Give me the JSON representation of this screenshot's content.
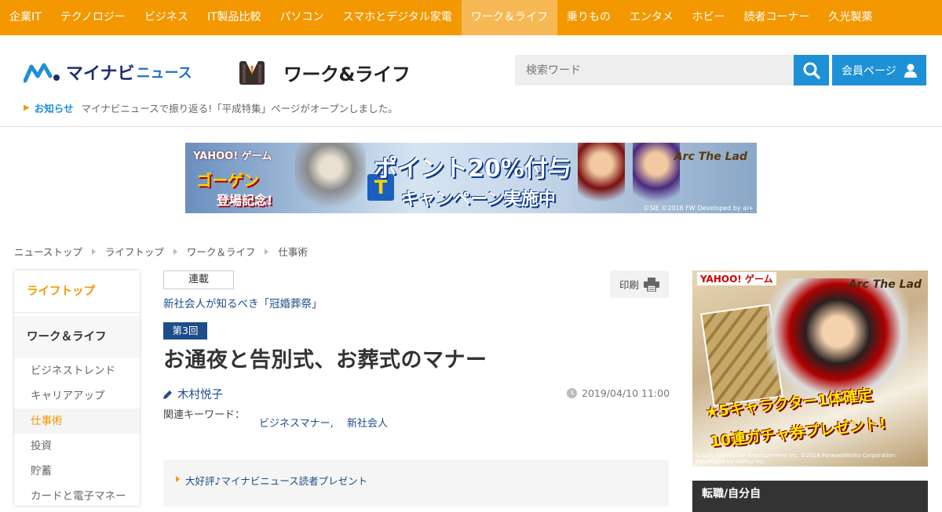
{
  "topnav": {
    "items": [
      "企業IT",
      "テクノロジー",
      "ビジネス",
      "IT製品比較",
      "パソコン",
      "スマホとデジタル家電",
      "ワーク＆ライフ",
      "乗りもの",
      "エンタメ",
      "ホビー",
      "読者コーナー",
      "久光製薬"
    ],
    "active_index": 6
  },
  "header": {
    "logo_main": "マイナビ",
    "logo_sub": "ニュース",
    "section_title": "ワーク&ライフ",
    "search_placeholder": "検索ワード",
    "member_label": "会員ページ",
    "notice_tag": "お知らせ",
    "notice_text": "マイナビニュースで振り返る!「平成特集」ページがオープンしました。"
  },
  "banner_ad": {
    "yahoo": "YAHOO! ゲーム",
    "headline1": "ゴーゲン",
    "headline2": "登場記念!",
    "point": "ポイント20%付与",
    "campaign": "キャンペーン実施中",
    "game_logo": "Arc The Lad",
    "copyright": "©SIE ©2018 FW Developed by ai+"
  },
  "breadcrumb": [
    "ニューストップ",
    "ライフトップ",
    "ワーク＆ライフ",
    "仕事術"
  ],
  "sidebar": {
    "top": "ライフトップ",
    "category": "ワーク＆ライフ",
    "items": [
      "ビジネストレンド",
      "キャリアアップ",
      "仕事術",
      "投資",
      "貯蓄",
      "カードと電子マネー"
    ],
    "active_index": 2
  },
  "article": {
    "series_tag": "連載",
    "series_title": "新社会人が知るべき「冠婚葬祭」",
    "print_label": "印刷",
    "episode": "第3回",
    "title": "お通夜と告別式、お葬式のマナー",
    "author": "木村悦子",
    "date": "2019/04/10 11:00",
    "keywords_label": "関連キーワード：",
    "keywords": [
      "ビジネスマナー,",
      "新社会人"
    ],
    "promo": "大好評♪マイナビニュース読者プレゼント"
  },
  "right_ad": {
    "yahoo": "YAHOO! ゲーム",
    "game_logo": "Arc The Lad",
    "copy1": "★5キャラクター1体確定",
    "copy2": "10連ガチャ券プレゼント!",
    "copyright": "©Sony Interactive Entertainment Inc. ©2018 ForwardWorks Corporation. Developed by AltPlus Inc."
  },
  "right_box_title": "転職/自分自",
  "colors": {
    "brand_orange": "#f39800",
    "brand_blue": "#1d90d6",
    "link_navy": "#1d4d8a"
  }
}
